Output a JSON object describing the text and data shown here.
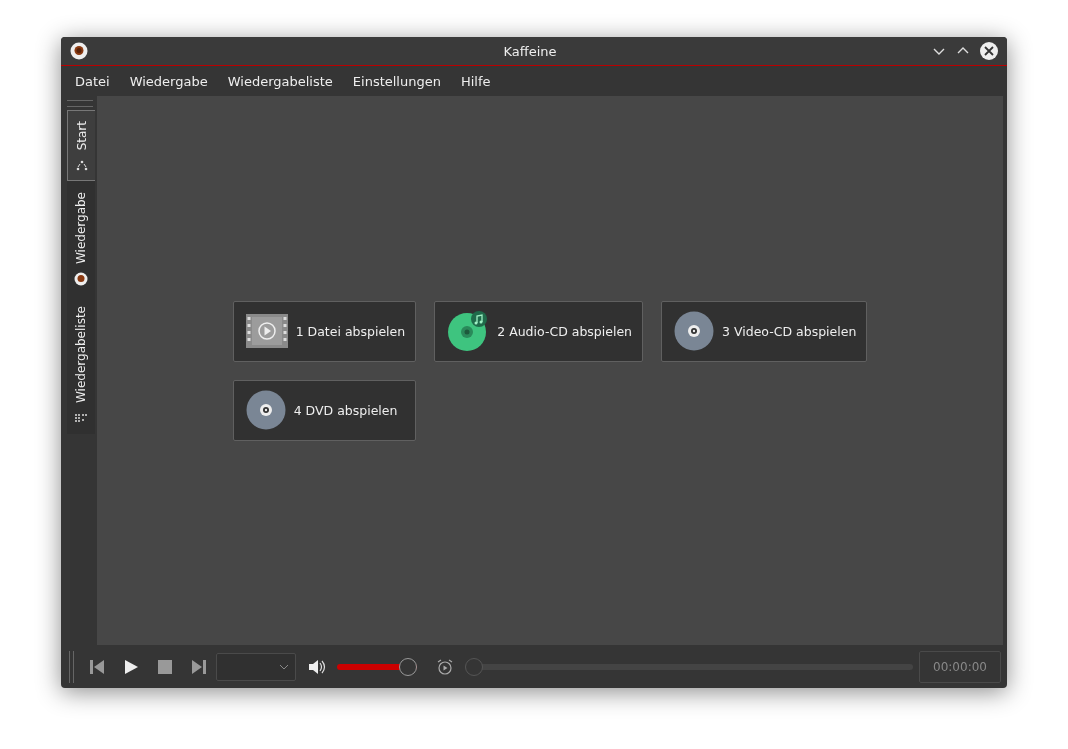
{
  "window": {
    "title": "Kaffeine"
  },
  "menu": [
    "Datei",
    "Wiedergabe",
    "Wiedergabeliste",
    "Einstellungen",
    "Hilfe"
  ],
  "side_tabs": [
    {
      "label": "Start",
      "kind": "start",
      "selected": true
    },
    {
      "label": "Wiedergabe",
      "kind": "player",
      "selected": false
    },
    {
      "label": "Wiedergabeliste",
      "kind": "playlist",
      "selected": false
    }
  ],
  "start_buttons": [
    {
      "label": "1 Datei abspielen",
      "kind": "file"
    },
    {
      "label": "2 Audio-CD abspielen",
      "kind": "audio-cd"
    },
    {
      "label": "3 Video-CD abspielen",
      "kind": "video-cd"
    },
    {
      "label": "4 DVD abspielen",
      "kind": "dvd"
    }
  ],
  "controls": {
    "volume": {
      "level": 1
    },
    "seek": {
      "level": 0
    },
    "time": "00:00:00"
  }
}
